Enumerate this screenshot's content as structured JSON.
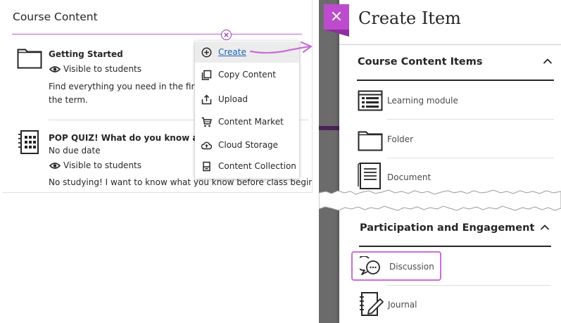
{
  "course_panel": {
    "title": "Course Content",
    "items": [
      {
        "title": "Getting Started",
        "visibility": "Visible to students",
        "description_line1": "Find everything you need in the first",
        "description_line2": "the term."
      },
      {
        "title": "POP QUIZ! What do you know abou",
        "due": "No due date",
        "visibility": "Visible to students",
        "description_line1": "No studying! I want to know what you know before class begins!"
      }
    ]
  },
  "create_menu": {
    "items": [
      {
        "label": "Create",
        "icon": "plus-circle-icon",
        "active": true
      },
      {
        "label": "Copy Content",
        "icon": "copy-icon"
      },
      {
        "label": "Upload",
        "icon": "upload-icon"
      },
      {
        "label": "Content Market",
        "icon": "cart-icon"
      },
      {
        "label": "Cloud Storage",
        "icon": "cloud-icon"
      },
      {
        "label": "Content Collection",
        "icon": "collection-icon"
      }
    ]
  },
  "create_item": {
    "title": "Create Item",
    "close_label": "×",
    "sections": [
      {
        "heading": "Course Content Items",
        "items": [
          {
            "label": "Learning module",
            "icon": "learning-module-icon"
          },
          {
            "label": "Folder",
            "icon": "folder-icon"
          },
          {
            "label": "Document",
            "icon": "document-icon"
          }
        ]
      },
      {
        "heading": "Participation and Engagement",
        "items": [
          {
            "label": "Discussion",
            "icon": "discussion-icon",
            "highlighted": true
          },
          {
            "label": "Journal",
            "icon": "journal-icon"
          }
        ]
      }
    ]
  },
  "colors": {
    "accent_purple": "#bd4ccc",
    "highlight_pink": "#c86fd6",
    "link_blue": "#1f63b7",
    "strip_gray": "#6b6b6b"
  }
}
